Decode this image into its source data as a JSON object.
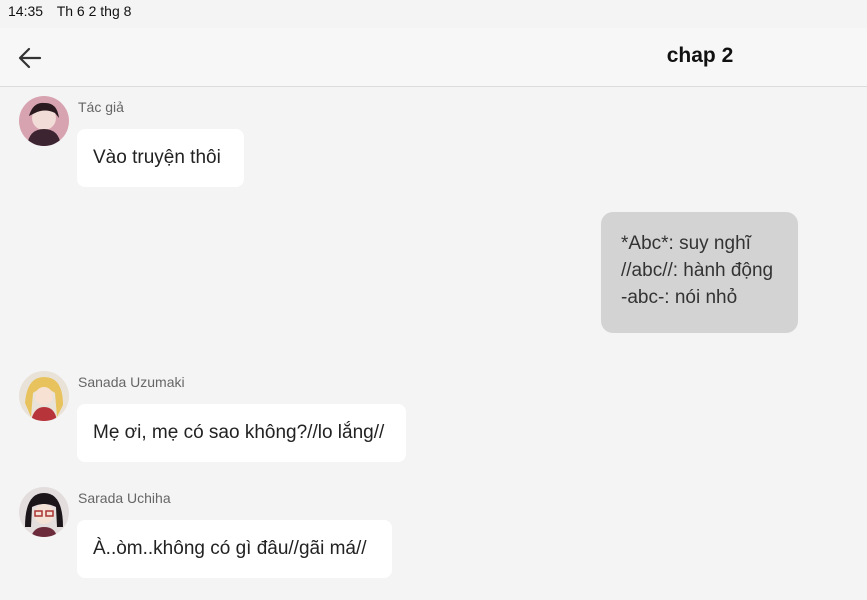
{
  "status_bar": {
    "time": "14:35",
    "date": "Th 6 2 thg 8"
  },
  "header": {
    "title": "chap 2"
  },
  "messages": [
    {
      "sender": "Tác giả",
      "text": "Vào truyện thôi"
    },
    {
      "lines": [
        "*Abc*: suy nghĩ",
        "//abc//: hành động",
        "-abc-: nói nhỏ"
      ]
    },
    {
      "sender": "Sanada Uzumaki",
      "text": "Mẹ ơi, mẹ có sao không?//lo lắng//"
    },
    {
      "sender": "Sarada Uchiha",
      "text": "À..òm..không có gì đâu//gãi má//"
    }
  ]
}
